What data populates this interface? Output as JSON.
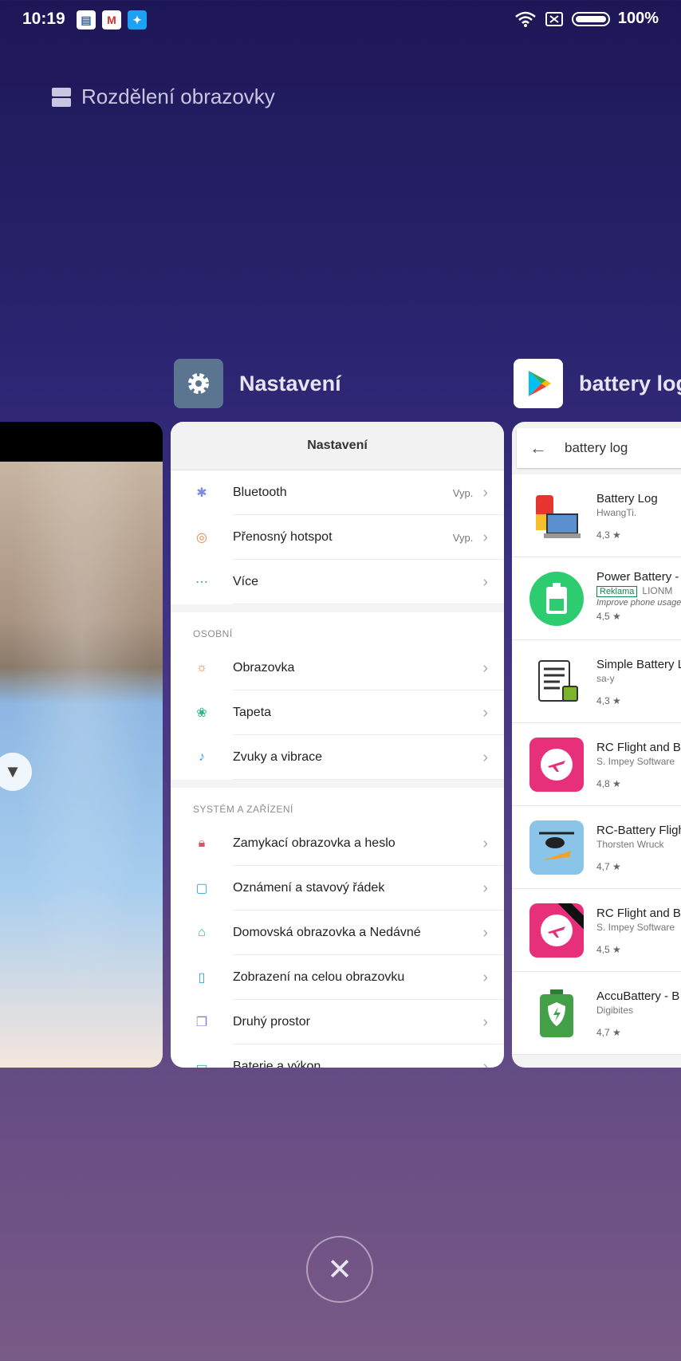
{
  "status_bar": {
    "time": "10:19",
    "battery": "100%"
  },
  "split_screen": {
    "label": "Rozdělení obrazovky"
  },
  "apps": {
    "settings_title": "Nastavení",
    "play_title": "battery log"
  },
  "settings": {
    "header": "Nastavení",
    "rows_top": [
      {
        "label": "Bluetooth",
        "value": "Vyp."
      },
      {
        "label": "Přenosný hotspot",
        "value": "Vyp."
      },
      {
        "label": "Více",
        "value": ""
      }
    ],
    "section_personal": "OSOBNÍ",
    "rows_personal": [
      {
        "label": "Obrazovka"
      },
      {
        "label": "Tapeta"
      },
      {
        "label": "Zvuky a vibrace"
      }
    ],
    "section_system": "SYSTÉM A ZAŘÍZENÍ",
    "rows_system": [
      {
        "label": "Zamykací obrazovka a heslo"
      },
      {
        "label": "Oznámení a stavový řádek"
      },
      {
        "label": "Domovská obrazovka a Nedávné"
      },
      {
        "label": "Zobrazení na celou obrazovku"
      },
      {
        "label": "Druhý prostor"
      },
      {
        "label": "Baterie a výkon"
      }
    ]
  },
  "play": {
    "query": "battery log",
    "results": [
      {
        "name": "Battery Log",
        "dev": "HwangTi.",
        "rating": "4,3 ★"
      },
      {
        "name": "Power Battery -",
        "ad": "Reklama",
        "dev": "LIONM",
        "sub": "Improve phone usage",
        "rating": "4,5 ★"
      },
      {
        "name": "Simple Battery L",
        "dev": "sa-y",
        "rating": "4,3 ★"
      },
      {
        "name": "RC Flight and B",
        "dev": "S. Impey Software",
        "rating": "4,8 ★"
      },
      {
        "name": "RC-Battery Fligh",
        "dev": "Thorsten Wruck",
        "rating": "4,7 ★"
      },
      {
        "name": "RC Flight and B",
        "dev": "S. Impey Software",
        "rating": "4,5 ★"
      },
      {
        "name": "AccuBattery - B",
        "dev": "Digibites",
        "rating": "4,7 ★"
      }
    ]
  },
  "colors": {
    "accent_green": "#0a8a4a",
    "settings_icon_bg": "#5b7590"
  }
}
